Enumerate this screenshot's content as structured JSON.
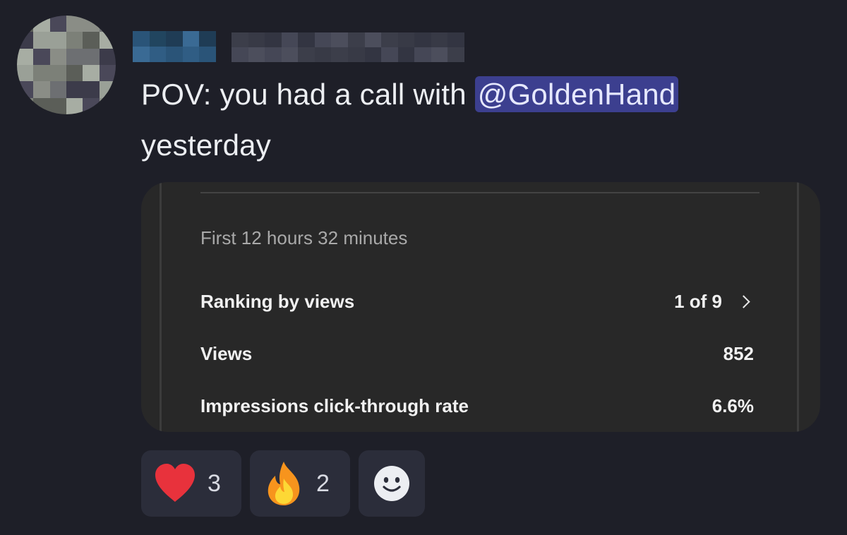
{
  "message": {
    "text_before": "POV: you had a call with ",
    "mention": "@GoldenHand",
    "text_after": " yesterday"
  },
  "embed": {
    "period": "First 12 hours 32 minutes",
    "rows": [
      {
        "label": "Ranking by views",
        "value": "1 of 9"
      },
      {
        "label": "Views",
        "value": "852"
      },
      {
        "label": "Impressions click-through rate",
        "value": "6.6%"
      }
    ]
  },
  "reactions": [
    {
      "icon": "heart-icon",
      "count": "3"
    },
    {
      "icon": "fire-icon",
      "count": "2"
    }
  ],
  "colors": {
    "background": "#1e1f28",
    "mention_bg": "#3c3f8f",
    "embed_bg": "#282828",
    "heart": "#e8323c"
  }
}
